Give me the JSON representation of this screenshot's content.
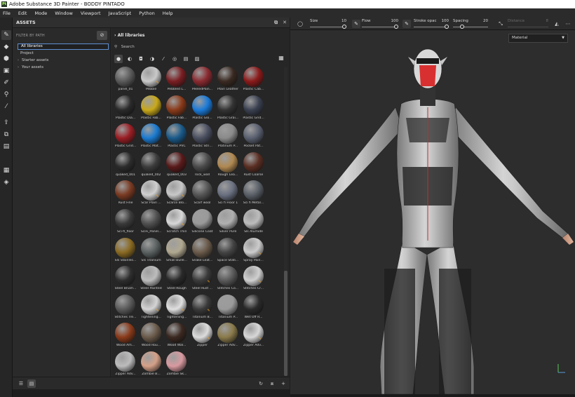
{
  "window": {
    "title": "Adobe Substance 3D Painter - BODDY PINTADO",
    "logo_text": "Pt"
  },
  "menu": [
    "File",
    "Edit",
    "Mode",
    "Window",
    "Viewport",
    "JavaScript",
    "Python",
    "Help"
  ],
  "toolstrip": [
    "paint-brush-icon",
    "eraser-icon",
    "projection-icon",
    "geometry-mask-icon",
    "smudge-icon",
    "clone-icon",
    "picker-icon",
    "bake-icon",
    "polygon-fill-icon",
    "layer-icon",
    "export-icon",
    "display-icon"
  ],
  "assets": {
    "header": "ASSETS",
    "filter_label": "FILTER BY PATH",
    "tree": [
      {
        "label": "All libraries",
        "selected": true,
        "chevron": ""
      },
      {
        "label": "Project",
        "selected": false,
        "chevron": ""
      },
      {
        "label": "Starter assets",
        "selected": false,
        "chevron": "›"
      },
      {
        "label": "Your assets",
        "selected": false,
        "chevron": "›"
      }
    ],
    "library_title": "All libraries",
    "search_placeholder": "Search",
    "thumbs": [
      {
        "label": "panel_01",
        "color": "#5a5a5a",
        "badge": false
      },
      {
        "label": "Pebble",
        "color": "#c9c9c9",
        "badge": true
      },
      {
        "label": "Pebbled L...",
        "color": "#7a1e22",
        "badge": false
      },
      {
        "label": "PeeledPain...",
        "color": "#8a2a30",
        "badge": false
      },
      {
        "label": "Plain Leather",
        "color": "#3a2a22",
        "badge": false
      },
      {
        "label": "Plastic Cab...",
        "color": "#8c1a1a",
        "badge": false
      },
      {
        "label": "Plastic Dia...",
        "color": "#2a2a2a",
        "badge": false
      },
      {
        "label": "Plastic Fab...",
        "color": "#c8a81a",
        "badge": false
      },
      {
        "label": "Plastic Fab...",
        "color": "#8a3a1a",
        "badge": false
      },
      {
        "label": "Plastic Glo...",
        "color": "#1a7ad8",
        "badge": false
      },
      {
        "label": "Plastic Grai...",
        "color": "#333333",
        "badge": false
      },
      {
        "label": "Plastic Grid...",
        "color": "#3a4050",
        "badge": false
      },
      {
        "label": "Plastic Grid...",
        "color": "#9a1e24",
        "badge": false
      },
      {
        "label": "Plastic Mat...",
        "color": "#1a7ad0",
        "badge": false
      },
      {
        "label": "Plastic PVC",
        "color": "#1a5a8a",
        "badge": false
      },
      {
        "label": "Plastic Stri...",
        "color": "#4a4f60",
        "badge": false
      },
      {
        "label": "Platinum P...",
        "color": "#8a8a8a",
        "badge": false
      },
      {
        "label": "Pocket Pat...",
        "color": "#5a6070",
        "badge": false
      },
      {
        "label": "quaked_001",
        "color": "#2c2c2c",
        "badge": false
      },
      {
        "label": "quaked_002",
        "color": "#3c3c3c",
        "badge": false
      },
      {
        "label": "quaked_003",
        "color": "#5a1a1a",
        "badge": false
      },
      {
        "label": "rock_wall",
        "color": "#4a4a4a",
        "badge": false
      },
      {
        "label": "Rough Lea...",
        "color": "#b08850",
        "badge": false
      },
      {
        "label": "Rust Coarse",
        "color": "#5a2e22",
        "badge": false
      },
      {
        "label": "Rust Fine",
        "color": "#7a3a22",
        "badge": false
      },
      {
        "label": "Scar Plain ...",
        "color": "#d0d0d0",
        "badge": true
      },
      {
        "label": "Scarce Blo...",
        "color": "#c8c8c8",
        "badge": true
      },
      {
        "label": "Scarf wool",
        "color": "#555555",
        "badge": false
      },
      {
        "label": "Sci fi Floor 1",
        "color": "#6a7080",
        "badge": false
      },
      {
        "label": "Sci fi Metal...",
        "color": "#5a6068",
        "badge": false
      },
      {
        "label": "Sci-fi_floor",
        "color": "#3a3a3a",
        "badge": false
      },
      {
        "label": "SciFi_Panel...",
        "color": "#505050",
        "badge": false
      },
      {
        "label": "Scratch Thin",
        "color": "#d8d8d8",
        "badge": true
      },
      {
        "label": "Silicone Coat",
        "color": "#9a9a9a",
        "badge": false
      },
      {
        "label": "Silver Pure",
        "color": "#b0b0b0",
        "badge": false
      },
      {
        "label": "Sls Alumide",
        "color": "#bcbcbc",
        "badge": false
      },
      {
        "label": "Sls Stainles...",
        "color": "#8a6a22",
        "badge": false
      },
      {
        "label": "Sls Titanium",
        "color": "#5a6060",
        "badge": false
      },
      {
        "label": "Small Bulle...",
        "color": "#b0a890",
        "badge": false
      },
      {
        "label": "Snake Leat...",
        "color": "#6a5a4a",
        "badge": false
      },
      {
        "label": "Space Stati...",
        "color": "#444444",
        "badge": false
      },
      {
        "label": "Spray Pain...",
        "color": "#cccccc",
        "badge": true
      },
      {
        "label": "Steel Brush...",
        "color": "#2e2e2e",
        "badge": false
      },
      {
        "label": "Steel Painted",
        "color": "#bcbcbc",
        "badge": false
      },
      {
        "label": "Steel Rough",
        "color": "#2a2a2a",
        "badge": false
      },
      {
        "label": "Steel Rust ...",
        "color": "#3a3a3a",
        "badge": true
      },
      {
        "label": "Stitches Co...",
        "color": "#5a5a5a",
        "badge": false
      },
      {
        "label": "Stitches Cr...",
        "color": "#d0d0d0",
        "badge": true
      },
      {
        "label": "Stitches Tre...",
        "color": "#5a5a5a",
        "badge": false
      },
      {
        "label": "Tightening...",
        "color": "#d4d4d4",
        "badge": true
      },
      {
        "label": "Tightening...",
        "color": "#e0e0e0",
        "badge": true
      },
      {
        "label": "Titanium B...",
        "color": "#3a3a3a",
        "badge": true
      },
      {
        "label": "Titanium P...",
        "color": "#9a9a9a",
        "badge": false
      },
      {
        "label": "Wet Off R...",
        "color": "#2a2a2a",
        "badge": false
      },
      {
        "label": "Wood Am...",
        "color": "#8a3a1a",
        "badge": false
      },
      {
        "label": "Wood Rou...",
        "color": "#6a5a4a",
        "badge": false
      },
      {
        "label": "Wood Wal...",
        "color": "#3a2820",
        "badge": false
      },
      {
        "label": "Zipper",
        "color": "#dcdcdc",
        "badge": true
      },
      {
        "label": "Zipper Adv...",
        "color": "#8a7a4a",
        "badge": false
      },
      {
        "label": "Zipper Adv...",
        "color": "#d8d8d8",
        "badge": true
      },
      {
        "label": "Zipper Adv...",
        "color": "#bcbcbc",
        "badge": false
      },
      {
        "label": "Zombie B...",
        "color": "#d4a088",
        "badge": false
      },
      {
        "label": "Zombie Sk...",
        "color": "#d89aa0",
        "badge": false
      }
    ]
  },
  "viewport_toolbar": {
    "size_label": "Size",
    "size_value": "10",
    "flow_label": "Flow",
    "flow_value": "100",
    "stroke_label": "Stroke opac",
    "stroke_value": "100",
    "spacing_label": "Spacing",
    "spacing_value": "20",
    "distance_label": "Distance",
    "distance_value": "8"
  },
  "viewport": {
    "display_mode": "Material"
  }
}
